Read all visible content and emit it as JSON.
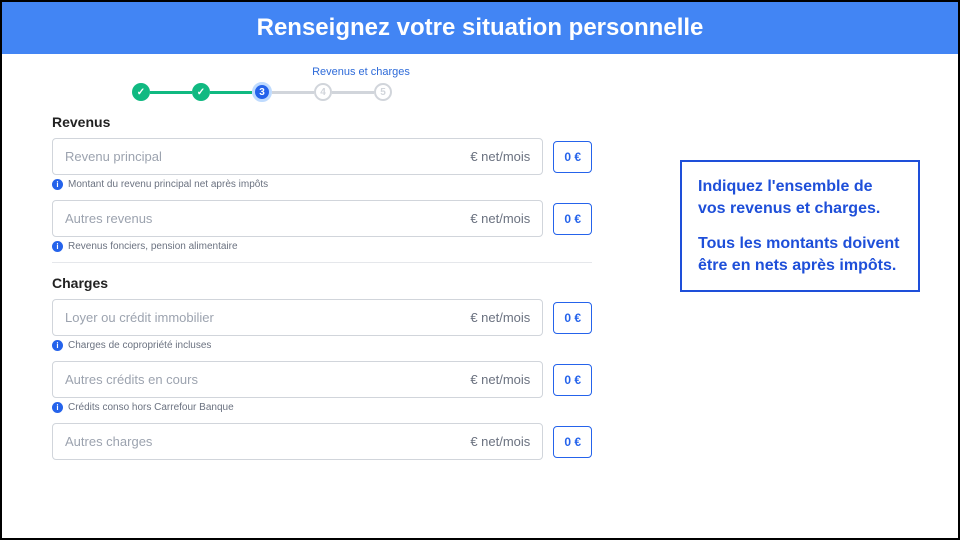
{
  "header": {
    "title": "Renseignez votre situation personnelle"
  },
  "stepper": {
    "label": "Revenus et charges",
    "active_number": "3",
    "future_4": "4",
    "future_5": "5"
  },
  "sections": {
    "revenus": {
      "title": "Revenus",
      "fields": [
        {
          "placeholder": "Revenu principal",
          "suffix": "€ net/mois",
          "value": "0 €",
          "help": "Montant du revenu principal net après impôts"
        },
        {
          "placeholder": "Autres revenus",
          "suffix": "€ net/mois",
          "value": "0 €",
          "help": "Revenus fonciers, pension alimentaire"
        }
      ]
    },
    "charges": {
      "title": "Charges",
      "fields": [
        {
          "placeholder": "Loyer ou crédit immobilier",
          "suffix": "€ net/mois",
          "value": "0 €",
          "help": "Charges de copropriété incluses"
        },
        {
          "placeholder": "Autres crédits en cours",
          "suffix": "€ net/mois",
          "value": "0 €",
          "help": "Crédits conso hors Carrefour Banque"
        },
        {
          "placeholder": "Autres charges",
          "suffix": "€ net/mois",
          "value": "0 €"
        }
      ]
    }
  },
  "callout": {
    "p1": "Indiquez l'ensemble de vos revenus et charges.",
    "p2": "Tous les montants doivent être en nets après impôts."
  }
}
